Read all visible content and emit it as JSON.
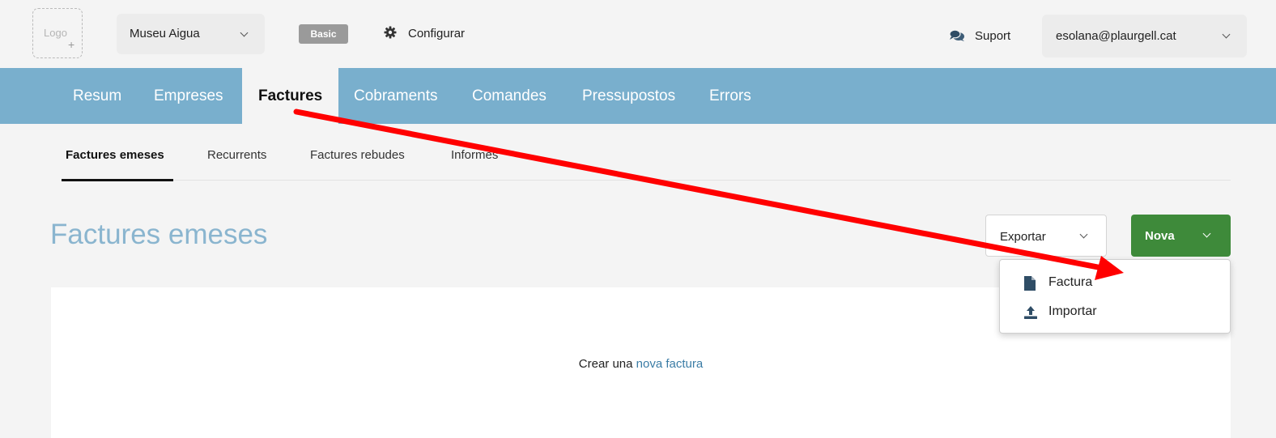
{
  "header": {
    "logo_text": "Logo",
    "logo_plus": "+",
    "company": "Museu Aigua",
    "plan_badge": "Basic",
    "config_label": "Configurar",
    "support_label": "Suport",
    "user_email": "esolana@plaurgell.cat"
  },
  "main_nav": {
    "items": [
      {
        "label": "Resum"
      },
      {
        "label": "Empreses"
      },
      {
        "label": "Factures"
      },
      {
        "label": "Cobraments"
      },
      {
        "label": "Comandes"
      },
      {
        "label": "Pressupostos"
      },
      {
        "label": "Errors"
      }
    ],
    "active": "Factures"
  },
  "sub_nav": {
    "items": [
      {
        "label": "Factures emeses"
      },
      {
        "label": "Recurrents"
      },
      {
        "label": "Factures rebudes"
      },
      {
        "label": "Informes"
      }
    ],
    "active": "Factures emeses"
  },
  "page": {
    "title": "Factures emeses",
    "export_label": "Exportar",
    "new_label": "Nova",
    "empty_prefix": "Crear una",
    "empty_link": "nova factura"
  },
  "new_menu": {
    "items": [
      {
        "label": "Factura",
        "icon": "document-icon"
      },
      {
        "label": "Importar",
        "icon": "upload-icon"
      }
    ]
  },
  "colors": {
    "nav_bg": "#79afcd",
    "primary_green": "#3e8a3a",
    "title_blue": "#8ab5cf",
    "link_blue": "#3a7ca5",
    "annotation_red": "#ff0000"
  }
}
